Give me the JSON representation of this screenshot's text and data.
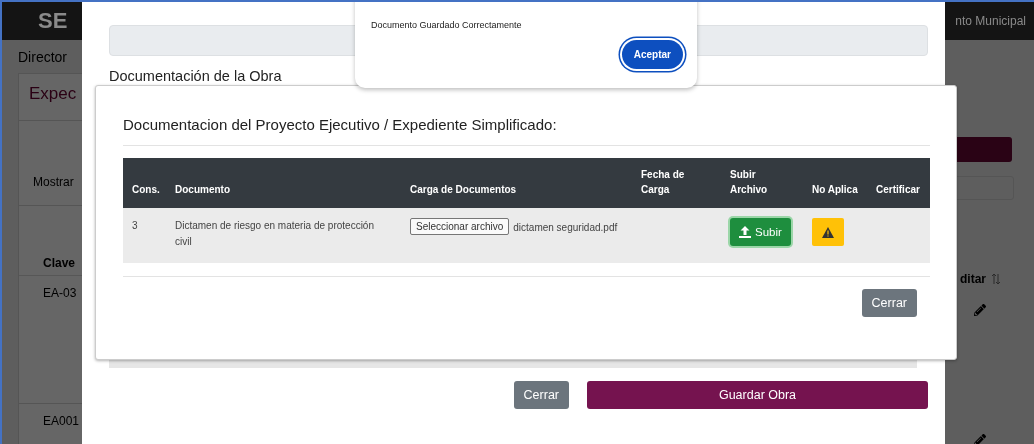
{
  "background_page": {
    "header_logo": "SE",
    "header_text": "nto Municipal",
    "breadcrumb": "Director",
    "card_title": "Expec",
    "show_label": "Mostrar",
    "columns": [
      "Clave",
      "ditar"
    ],
    "rows": [
      {
        "clave": "EA-03"
      },
      {
        "clave": "EA001"
      }
    ]
  },
  "modal": {
    "title": "Documentación de la Obra",
    "buttons": [
      {
        "label": "Cerrar",
        "kind": "secondary"
      },
      {
        "label": "Guardar Obra",
        "kind": "primary"
      }
    ]
  },
  "inner_modal": {
    "title": "Documentacion del Proyecto Ejecutivo / Expediente Simplificado:",
    "table": {
      "columns": [
        "Cons.",
        "Documento",
        "Carga de Documentos",
        "Fecha de Carga",
        "Subir Archivo",
        "No Aplica",
        "Certificar"
      ],
      "rows": [
        {
          "cons": "3",
          "document": "Dictamen de riesgo en materia de protección civil",
          "file_button": "Seleccionar archivo",
          "file_name": "dictamen seguridad.pdf",
          "upload_button": "Subir"
        }
      ]
    },
    "close_button": "Cerrar"
  },
  "alert": {
    "message": "Documento Guardado Correctamente",
    "button": "Aceptar"
  }
}
